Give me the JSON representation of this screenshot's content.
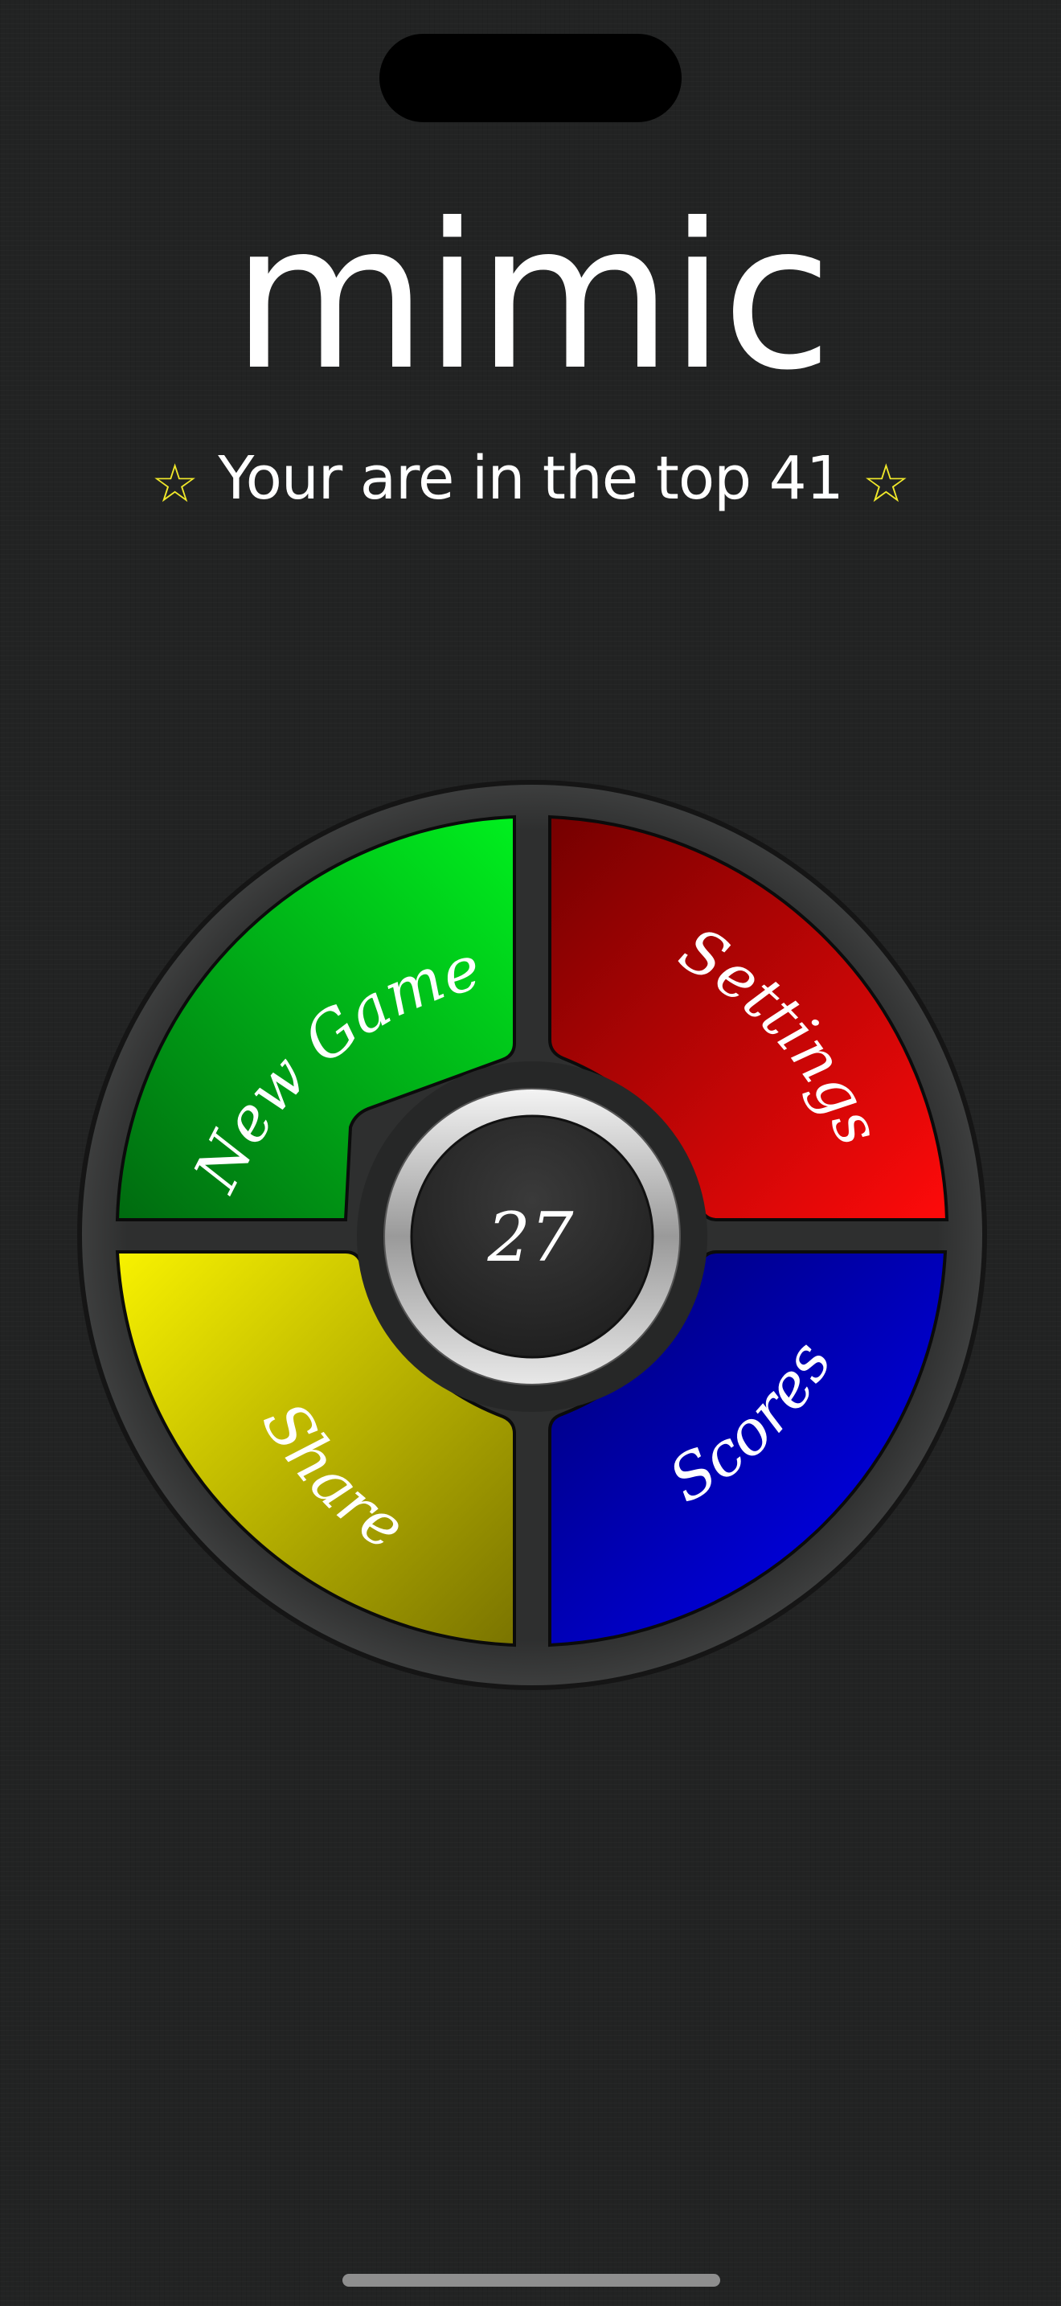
{
  "app": {
    "title": "mimic",
    "rank_text": "Your are in the top 41",
    "star_glyph": "☆"
  },
  "menu": {
    "new_game": "New Game",
    "settings": "Settings",
    "share": "Share",
    "scores": "Scores",
    "center_value": "27"
  },
  "colors": {
    "background": "#222323",
    "green": "#00d21a",
    "red": "#d40000",
    "yellow": "#e8e200",
    "blue": "#0000e0",
    "star": "#f0e82a"
  }
}
